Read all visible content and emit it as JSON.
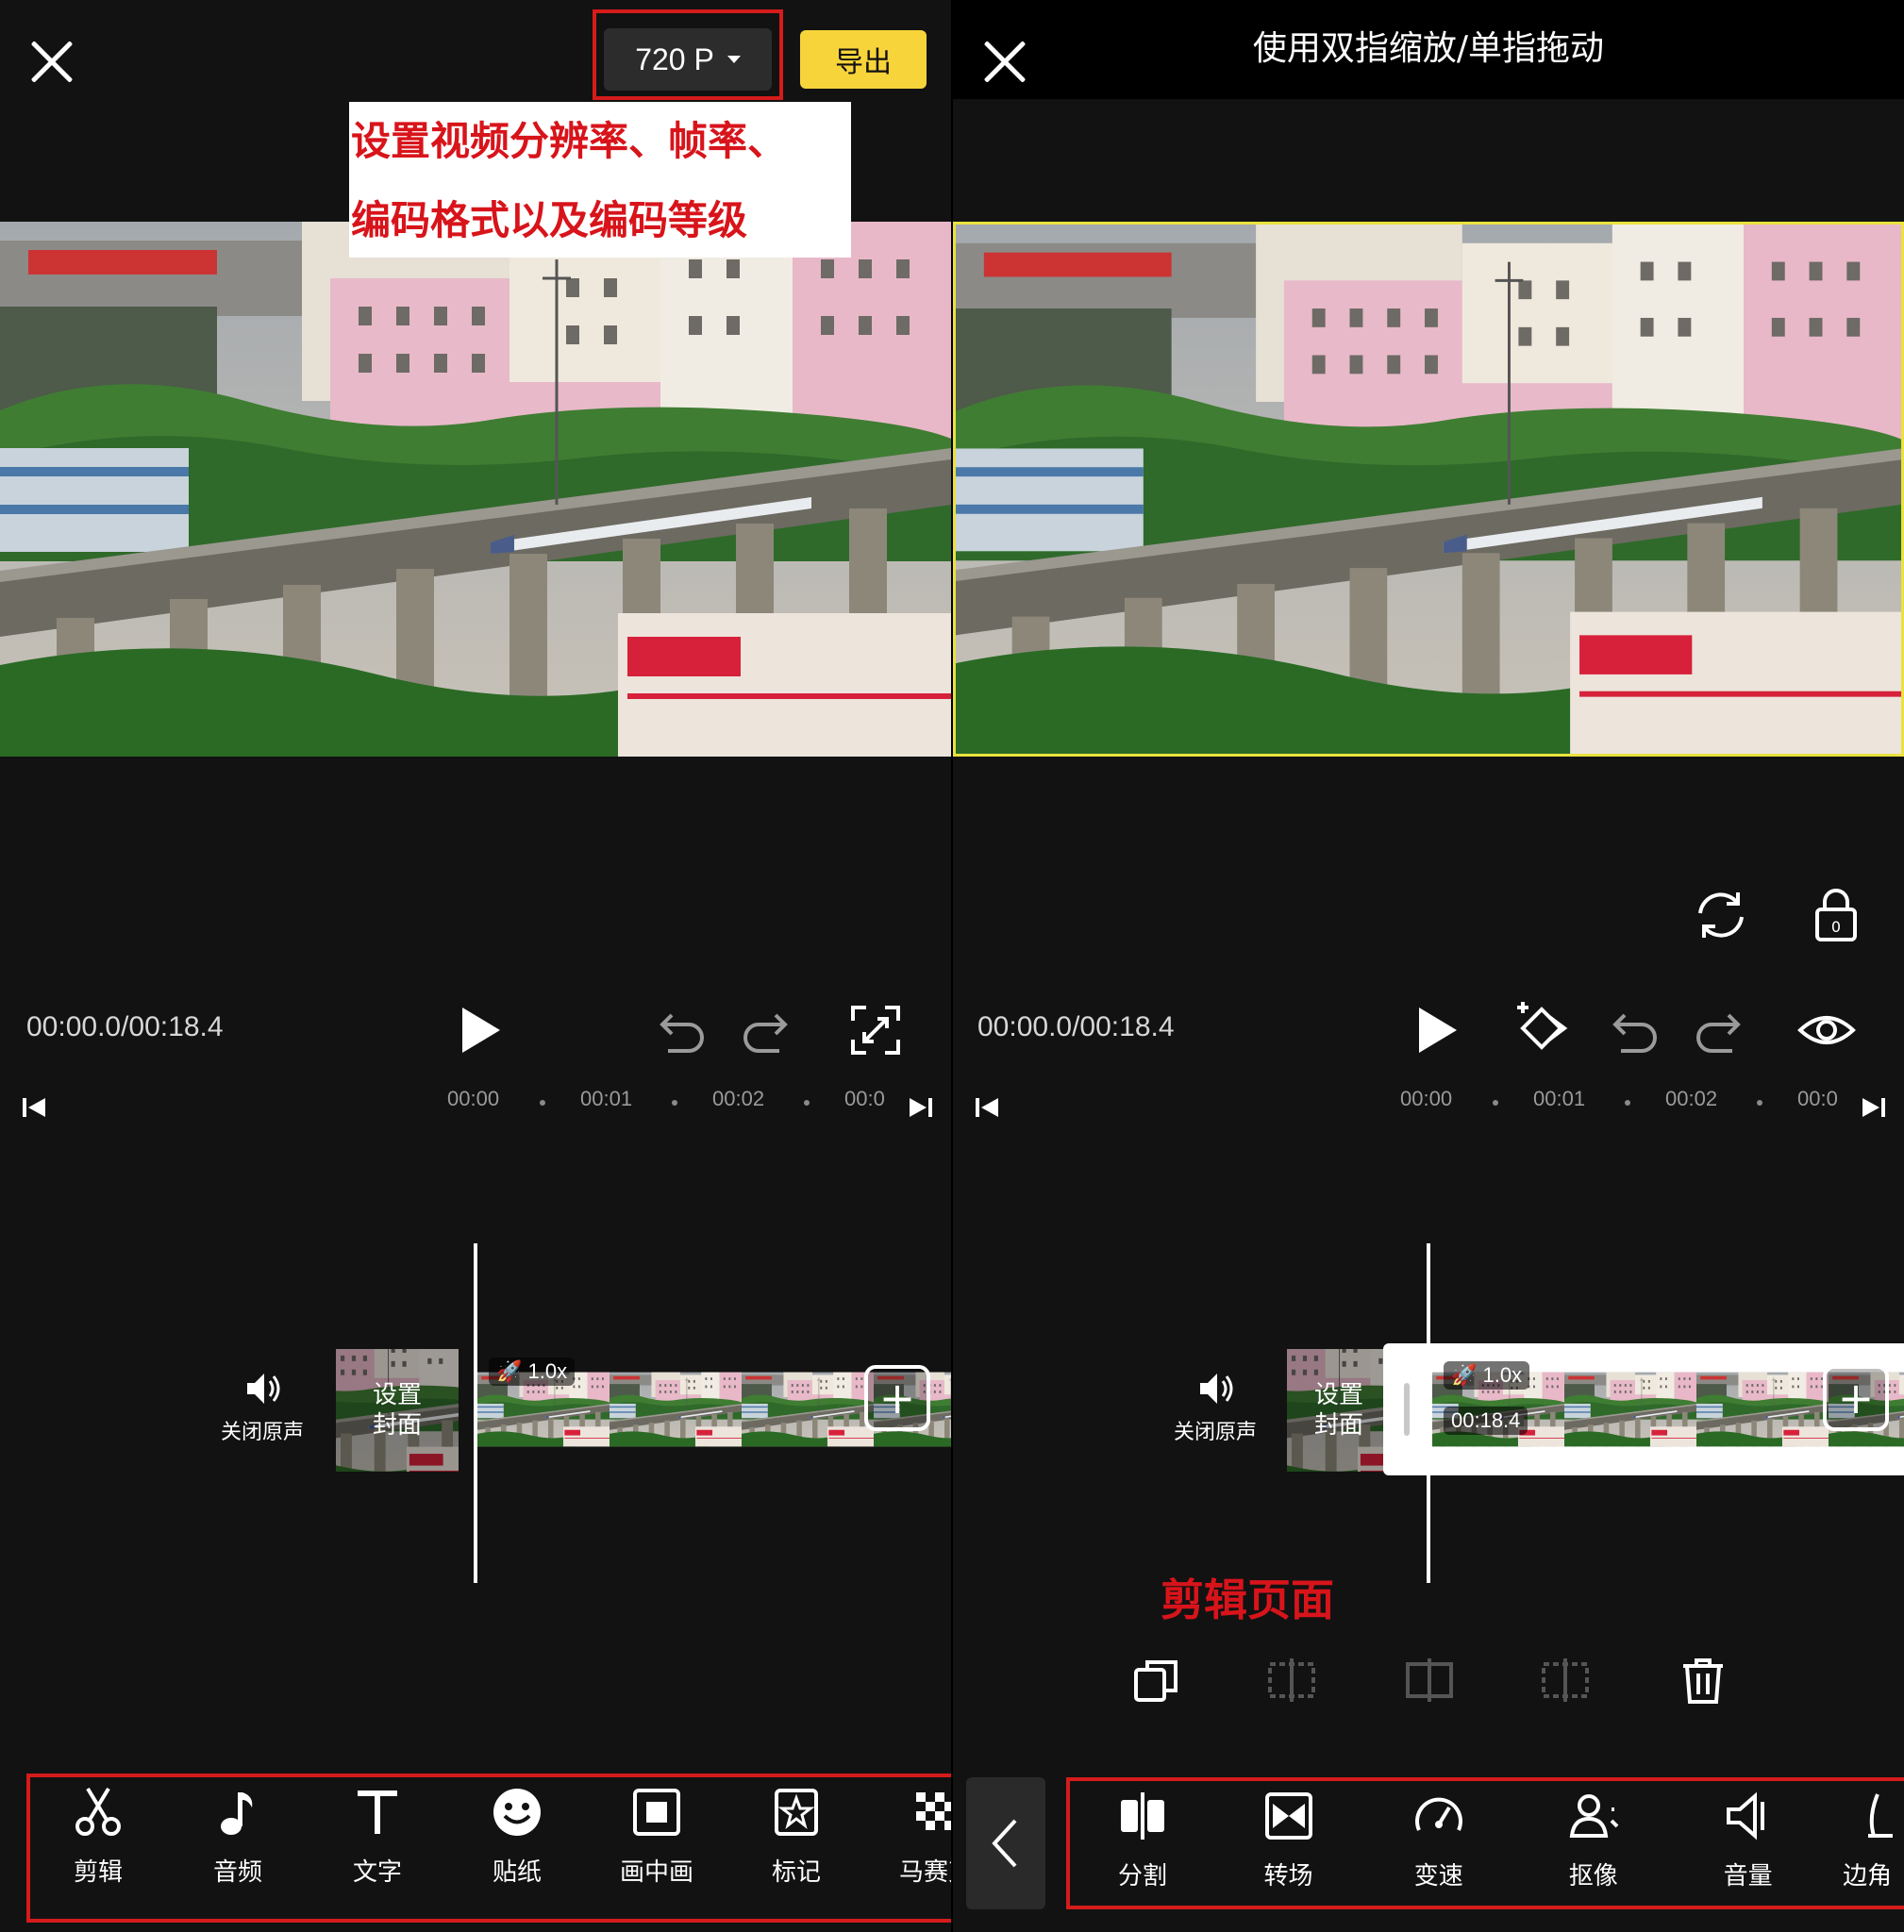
{
  "left": {
    "resolution_label": "720 P",
    "export_label": "导出",
    "callout_lines": [
      "设置视频分辨率、帧率、",
      "编码格式以及编码等级"
    ],
    "time": "00:00.0/00:18.4",
    "ruler": [
      "00:00",
      "00:01",
      "00:02",
      "00:0"
    ],
    "mute_label": "关闭原声",
    "cover_label": "设置\n封面",
    "speed": "1.0x",
    "tools": [
      {
        "label": "剪辑",
        "icon": "scissors-icon"
      },
      {
        "label": "音频",
        "icon": "music-note-icon"
      },
      {
        "label": "文字",
        "icon": "text-icon"
      },
      {
        "label": "贴纸",
        "icon": "smiley-icon"
      },
      {
        "label": "画中画",
        "icon": "picture-in-picture-icon"
      },
      {
        "label": "标记",
        "icon": "star-bookmark-icon"
      },
      {
        "label": "马赛克",
        "icon": "mosaic-icon"
      }
    ]
  },
  "right": {
    "hint_title": "使用双指缩放/单指拖动",
    "time": "00:00.0/00:18.4",
    "ruler": [
      "00:00",
      "00:01",
      "00:02",
      "00:0"
    ],
    "mute_label": "关闭原声",
    "cover_label": "设置\n封面",
    "speed": "1.0x",
    "duration": "00:18.4",
    "page_label": "剪辑页面",
    "tools": [
      {
        "label": "分割",
        "icon": "split-icon"
      },
      {
        "label": "转场",
        "icon": "transition-icon"
      },
      {
        "label": "变速",
        "icon": "speed-gauge-icon"
      },
      {
        "label": "抠像",
        "icon": "cutout-person-icon"
      },
      {
        "label": "音量",
        "icon": "volume-icon"
      },
      {
        "label": "边角",
        "icon": "corner-icon"
      }
    ]
  },
  "colors": {
    "accent_yellow": "#f7d43a",
    "annotation_red": "#d61b1b",
    "selection_yellow": "#e9e23f"
  }
}
